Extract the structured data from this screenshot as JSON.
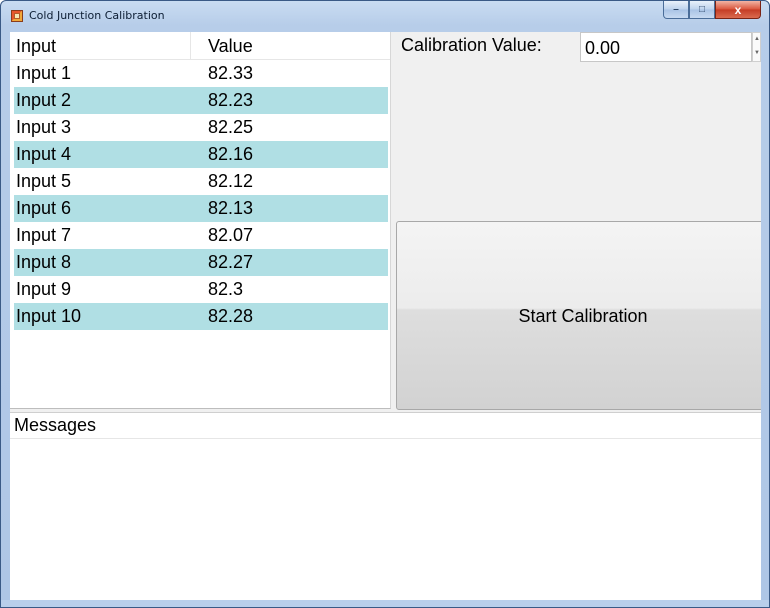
{
  "window": {
    "title": "Cold Junction Calibration",
    "controls": {
      "minimize": "–",
      "maximize": "□",
      "close": "x"
    }
  },
  "list": {
    "columns": [
      "Input",
      "Value"
    ],
    "rows": [
      {
        "input": "Input 1",
        "value": "82.33"
      },
      {
        "input": "Input 2",
        "value": "82.23"
      },
      {
        "input": "Input 3",
        "value": "82.25"
      },
      {
        "input": "Input 4",
        "value": "82.16"
      },
      {
        "input": "Input 5",
        "value": "82.12"
      },
      {
        "input": "Input 6",
        "value": "82.13"
      },
      {
        "input": "Input 7",
        "value": "82.07"
      },
      {
        "input": "Input 8",
        "value": "82.27"
      },
      {
        "input": "Input 9",
        "value": "82.3"
      },
      {
        "input": "Input 10",
        "value": "82.28"
      }
    ],
    "alt_row_color": "#b0dfe4"
  },
  "calibration": {
    "label": "Calibration Value:",
    "value": "0.00"
  },
  "start_button": {
    "label": "Start Calibration"
  },
  "messages": {
    "header": "Messages"
  }
}
